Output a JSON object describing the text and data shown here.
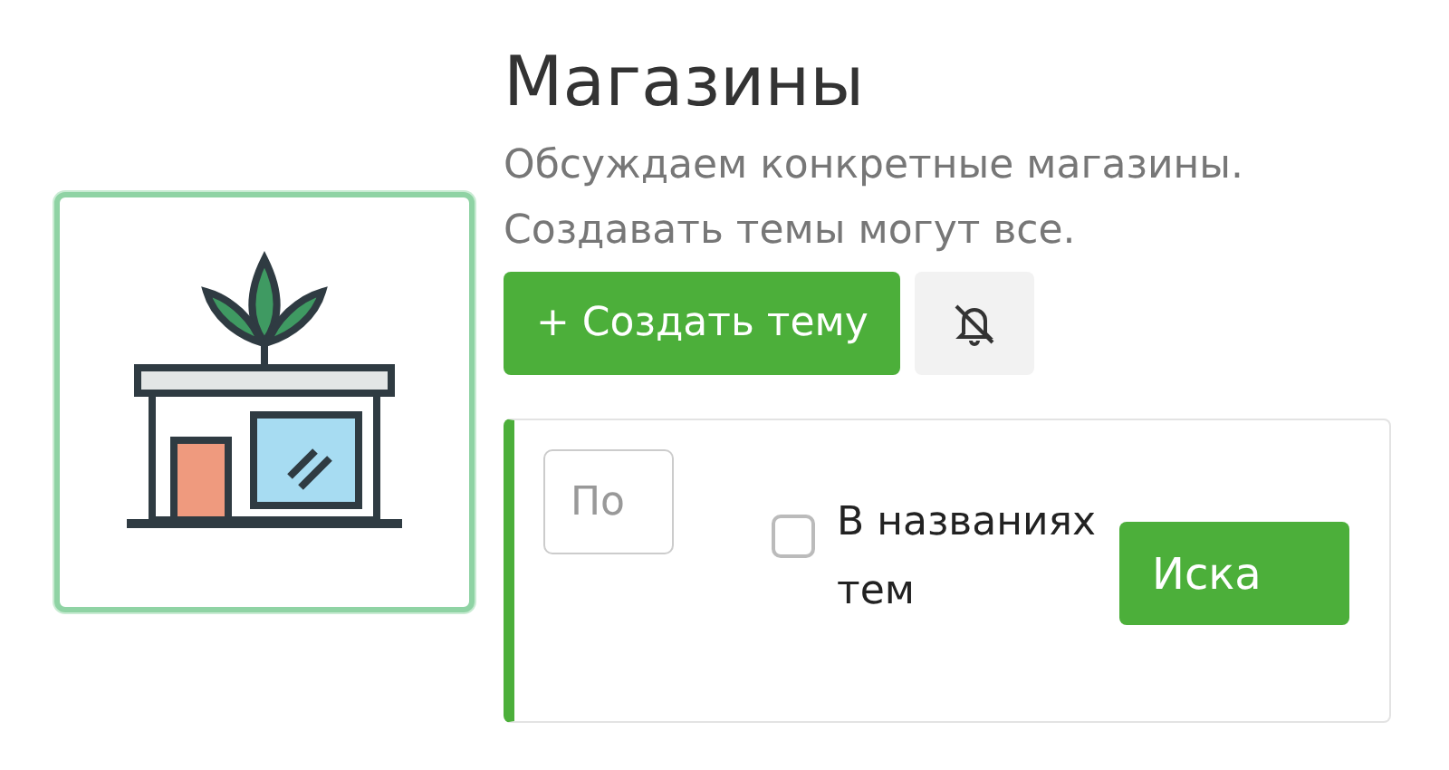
{
  "forum": {
    "title": "Магазины",
    "description": "Обсуждаем конкретные магазины. Создавать темы могут все.",
    "create_button": "+ Создать тему",
    "subscribed": false
  },
  "search": {
    "placeholder": "По",
    "titles_only": {
      "label": "В названиях тем",
      "checked": false
    },
    "button": "Иска"
  }
}
